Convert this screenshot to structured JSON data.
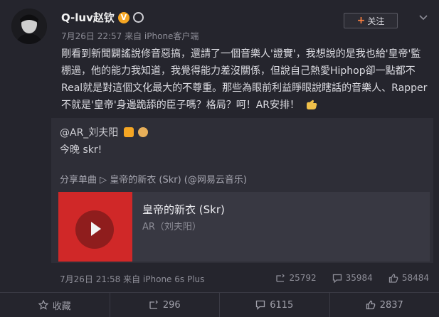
{
  "user": {
    "name": "Q-luv赵钦",
    "verified_badge": "V"
  },
  "post": {
    "meta": "7月26日 22:57 来自 iPhone客户端",
    "text": "剛看到新聞闢謠說修音惡搞，還請了一個音樂人'證實'，我想說的是我也給'皇帝'監棚過，他的能力我知道，我覺得能力差沒關係，但說自己熱愛Hiphop卻一點都不Real就是對這個文化最大的不尊重。那些為眼前利益睜眼說瞎話的音樂人、Rapper不就是'皇帝'身邊跪舔的臣子嗎？格局？呵！AR安排！"
  },
  "follow_button": {
    "label": "关注"
  },
  "repost": {
    "user": "@AR_刘夫阳",
    "text": "今晚 skr!",
    "share": "分享单曲 ▷ 皇帝的新衣 (Skr) (@网易云音乐)",
    "song_title": "皇帝的新衣 (Skr)",
    "artist": "AR（刘夫阳）",
    "meta": "7月26日 21:58 来自 iPhone 6s Plus",
    "stats": {
      "reposts": "25792",
      "comments": "35984",
      "likes": "58484"
    }
  },
  "actions": {
    "favorite": "收藏",
    "repost": "296",
    "comment": "6115",
    "like": "2837"
  },
  "colors": {
    "background": "#25252d",
    "card": "#2e2e37",
    "accent": "#ff8140",
    "cover_red": "#d02828"
  }
}
